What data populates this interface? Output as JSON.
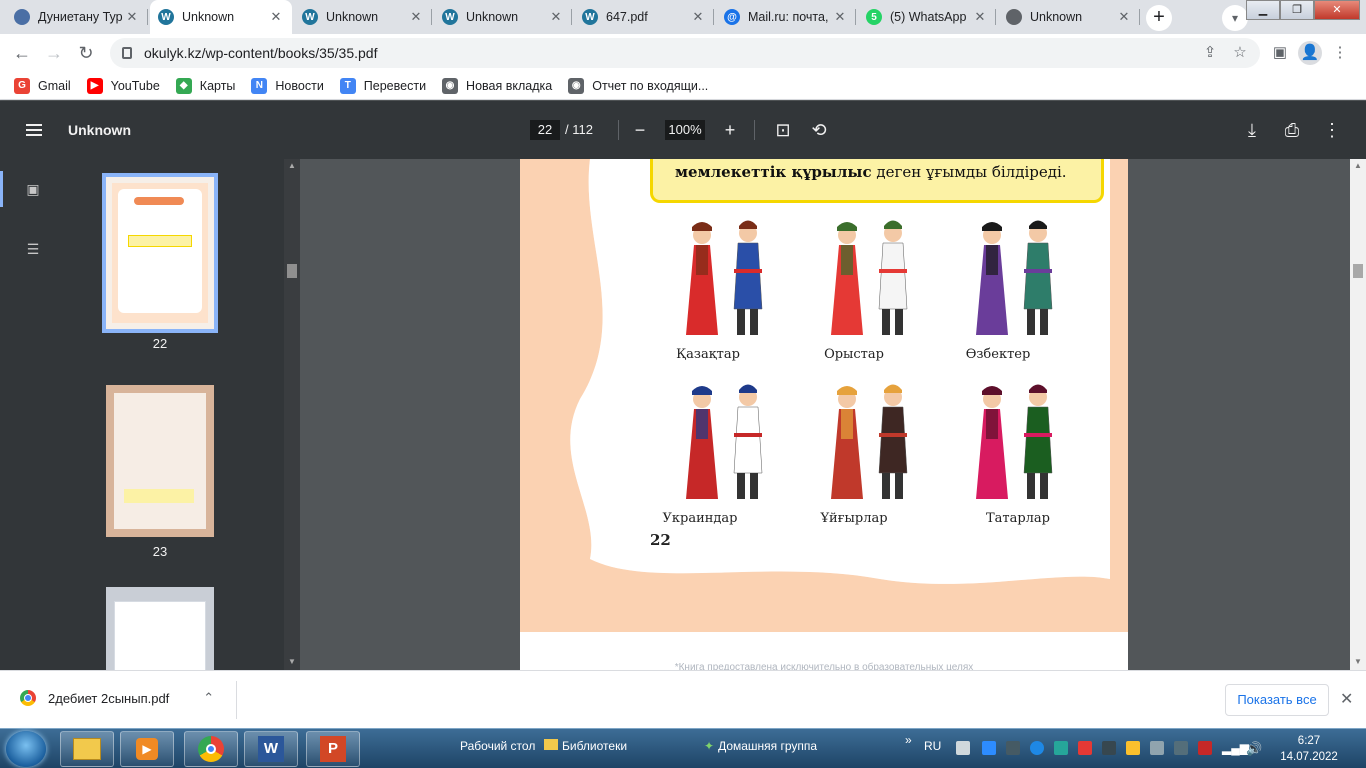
{
  "browser": {
    "tabs": [
      {
        "label": "Дуниетану Тур",
        "icon": "book-icon",
        "color": "#4a6fa5",
        "active": false
      },
      {
        "label": "Unknown",
        "icon": "wordpress-icon",
        "color": "#21759b",
        "active": true
      },
      {
        "label": "Unknown",
        "icon": "wordpress-icon",
        "color": "#21759b",
        "active": false
      },
      {
        "label": "Unknown",
        "icon": "wordpress-icon",
        "color": "#21759b",
        "active": false
      },
      {
        "label": "647.pdf",
        "icon": "wordpress-icon",
        "color": "#21759b",
        "active": false
      },
      {
        "label": "Mail.ru: почта,",
        "icon": "mailru-icon",
        "color": "#1a73e8",
        "active": false
      },
      {
        "label": "(5) WhatsApp",
        "icon": "whatsapp-icon",
        "color": "#25d366",
        "active": false
      },
      {
        "label": "Unknown",
        "icon": "globe-icon",
        "color": "#5f6368",
        "active": false
      }
    ],
    "url": "okulyk.kz/wp-content/books/35/35.pdf",
    "bookmarks": [
      {
        "label": "Gmail",
        "icon": "google-icon",
        "color": "#ea4335"
      },
      {
        "label": "YouTube",
        "icon": "youtube-icon",
        "color": "#ff0000"
      },
      {
        "label": "Карты",
        "icon": "maps-icon",
        "color": "#34a853"
      },
      {
        "label": "Новости",
        "icon": "news-icon",
        "color": "#4285f4"
      },
      {
        "label": "Перевести",
        "icon": "translate-icon",
        "color": "#4285f4"
      },
      {
        "label": "Новая вкладка",
        "icon": "globe-icon",
        "color": "#5f6368"
      },
      {
        "label": "Отчет по входящи...",
        "icon": "globe-icon",
        "color": "#5f6368"
      }
    ]
  },
  "pdf": {
    "title": "Unknown",
    "current_page": "22",
    "total_pages": "/ 112",
    "zoom": "100%",
    "thumbnails": [
      {
        "num": "22",
        "selected": true
      },
      {
        "num": "23",
        "selected": false
      },
      {
        "num": "",
        "selected": false
      }
    ]
  },
  "page_content": {
    "callout_bold": "мемлекеттік құрылыс",
    "callout_rest": " деген ұғымды білдіреді.",
    "captions": [
      "Қазақтар",
      "Орыстар",
      "Өзбектер",
      "Украиндар",
      "Ұйғырлар",
      "Татарлар"
    ],
    "page_number": "22",
    "footer_note": "*Книга предоставлена исключительно в образовательных целях"
  },
  "downloads": {
    "file": "2дебиет 2сынып.pdf",
    "show_all": "Показать все"
  },
  "taskbar": {
    "desktop": "Рабочий стол",
    "libraries": "Библиотеки",
    "homegroup": "Домашняя группа",
    "lang": "RU",
    "time": "6:27",
    "date": "14.07.2022"
  }
}
